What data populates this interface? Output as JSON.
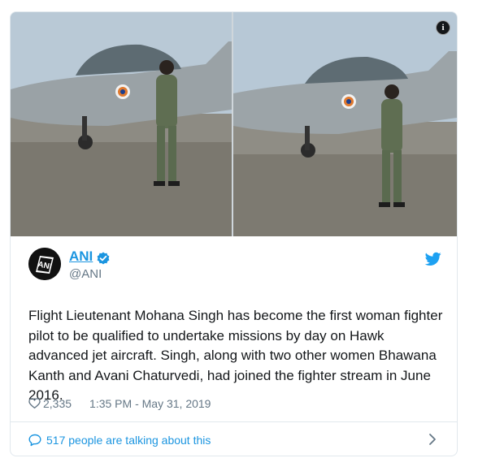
{
  "tweet": {
    "author_name": "ANI",
    "handle": "@ANI",
    "text": "Flight Lieutenant Mohana Singh has become the first woman fighter pilot to be qualified to undertake missions by day on Hawk advanced jet aircraft. Singh, along with two other women Bhawana Kanth and Avani Chaturvedi, had joined the fighter stream in June 2016.",
    "likes": "2,335",
    "timestamp": "1:35 PM - May 31, 2019",
    "talking": "517 people are talking about this",
    "avatar_text": "ANI"
  },
  "icons": {
    "info": "info-icon",
    "verified": "verified-badge-icon",
    "bird": "twitter-bird-icon",
    "heart": "heart-icon",
    "bubble": "speech-bubble-icon",
    "chevron": "chevron-right-icon"
  },
  "colors": {
    "link_blue": "#1b95e0",
    "muted": "#657786",
    "text": "#14171a",
    "border": "#e1e8ed"
  }
}
